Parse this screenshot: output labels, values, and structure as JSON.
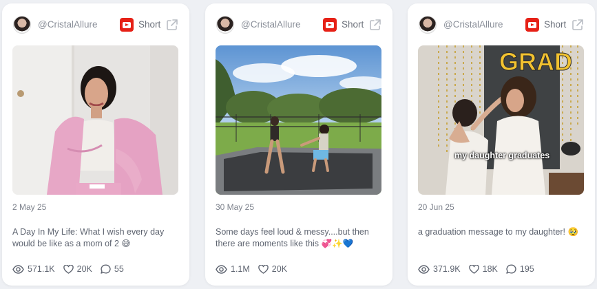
{
  "cards": [
    {
      "handle": "@CristalAllure",
      "type_label": "Short",
      "date": "2 May 25",
      "title": "A Day In My Life: What I wish every day would be like as a mom of 2 😅",
      "views": "571.1K",
      "likes": "20K",
      "comments": "55",
      "overlay_text": ""
    },
    {
      "handle": "@CristalAllure",
      "type_label": "Short",
      "date": "30 May 25",
      "title": "Some days feel loud & messy....but then there are moments like this 💞✨💙",
      "views": "1.1M",
      "likes": "20K",
      "comments": "",
      "overlay_text": ""
    },
    {
      "handle": "@CristalAllure",
      "type_label": "Short",
      "date": "20 Jun 25",
      "title": "a graduation message to my daughter! 🥹",
      "views": "371.9K",
      "likes": "18K",
      "comments": "195",
      "overlay_text": "my daughter graduates",
      "sign_text": "GRAD"
    }
  ],
  "colors": {
    "youtube_red": "#e62117",
    "text_muted": "#8a8f99",
    "text_body": "#5e6470",
    "card_bg": "#ffffff",
    "page_bg": "#eef0f4"
  },
  "icons": {
    "platform": "youtube-icon",
    "external": "external-link-icon",
    "views": "eye-icon",
    "likes": "heart-icon",
    "comments": "comment-icon"
  }
}
